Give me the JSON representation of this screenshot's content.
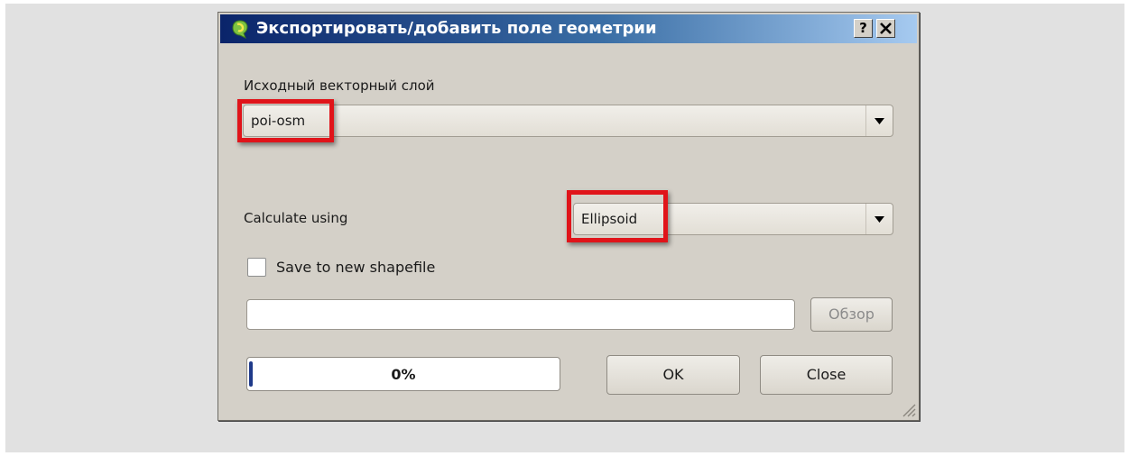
{
  "dialog": {
    "title": "Экспортировать/добавить поле геометрии",
    "help_button": "?",
    "close_button": "✕",
    "icon": "qgis-logo-icon"
  },
  "source_layer": {
    "label": "Исходный векторный слой",
    "value": "poi-osm"
  },
  "calculate": {
    "label": "Calculate using",
    "value": "Ellipsoid"
  },
  "save_to_shapefile": {
    "label": "Save to new shapefile",
    "checked": false
  },
  "output_path": {
    "value": "",
    "browse_label": "Обзор"
  },
  "progress": {
    "text": "0%",
    "value": 0
  },
  "buttons": {
    "ok": "OK",
    "close": "Close"
  },
  "colors": {
    "highlight": "#e0141a",
    "title_bar": "#0a246a",
    "dialog_bg": "#d4d0c8"
  }
}
